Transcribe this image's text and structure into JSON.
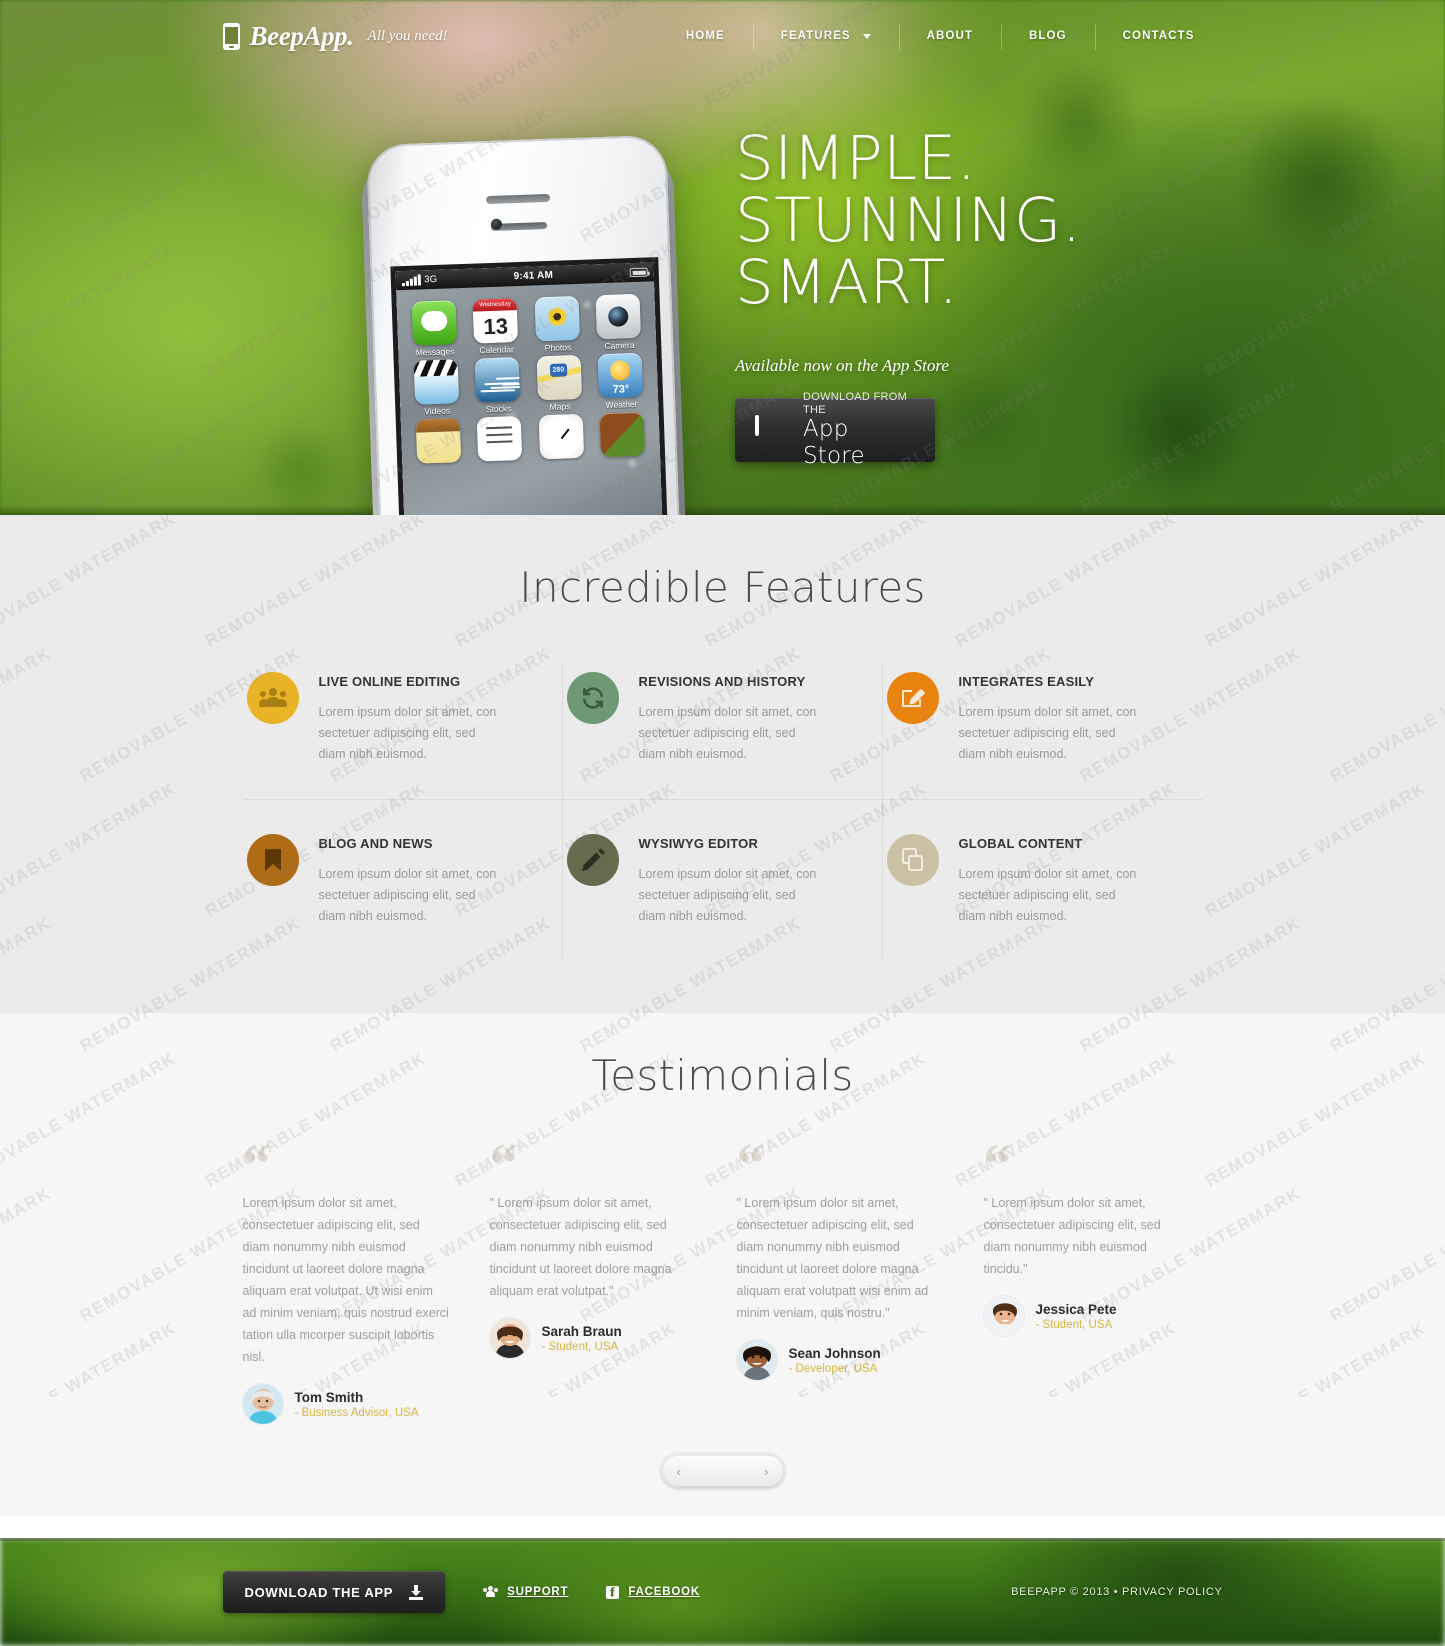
{
  "header": {
    "logo": {
      "name": "BeepApp.",
      "tagline": "All you need!",
      "icon": "phone-icon"
    },
    "nav": [
      {
        "label": "HOME",
        "has_dropdown": false
      },
      {
        "label": "FEATURES",
        "has_dropdown": true
      },
      {
        "label": "ABOUT",
        "has_dropdown": false
      },
      {
        "label": "BLOG",
        "has_dropdown": false
      },
      {
        "label": "CONTACTS",
        "has_dropdown": false
      }
    ]
  },
  "hero": {
    "headline_line1": "SIMPLE.",
    "headline_line2": "STUNNING.",
    "headline_line3": "SMART.",
    "subtitle": "Available now on the App Store",
    "cta": {
      "small": "DOWNLOAD FROM THE",
      "big": "App Store",
      "icon": "monitor-icon"
    },
    "phone": {
      "carrier": "3G",
      "time": "9:41 AM",
      "apps": [
        {
          "label": "Messages"
        },
        {
          "label": "Calendar",
          "weekday": "Wednesday",
          "day": "13"
        },
        {
          "label": "Photos"
        },
        {
          "label": "Camera"
        },
        {
          "label": "Videos"
        },
        {
          "label": "Stocks"
        },
        {
          "label": "Maps",
          "route": "280"
        },
        {
          "label": "Weather",
          "temp": "73°"
        }
      ]
    }
  },
  "features": {
    "title": "Incredible Features",
    "items": [
      {
        "title": "LIVE ONLINE EDITING",
        "text": "Lorem ipsum dolor sit amet, con sectetuer adipiscing elit, sed diam nibh euismod.",
        "icon": "users-icon",
        "color": "#e8b327",
        "glyph_color": "#a87f12"
      },
      {
        "title": "REVISIONS AND HISTORY",
        "text": "Lorem ipsum dolor sit amet, con sectetuer adipiscing elit, sed diam nibh euismod.",
        "icon": "refresh-icon",
        "color": "#6f9874",
        "glyph_color": "#3c5a41"
      },
      {
        "title": "INTEGRATES EASILY",
        "text": "Lorem ipsum dolor sit amet, con sectetuer adipiscing elit, sed diam nibh euismod.",
        "icon": "edit-box-icon",
        "color": "#e8830f",
        "glyph_color": "#f6e9d5"
      },
      {
        "title": "BLOG AND NEWS",
        "text": "Lorem ipsum dolor sit amet, con sectetuer adipiscing elit, sed diam nibh euismod.",
        "icon": "bookmark-icon",
        "color": "#b06c15",
        "glyph_color": "#5c3806"
      },
      {
        "title": "WYSIWYG EDITOR",
        "text": "Lorem ipsum dolor sit amet, con sectetuer adipiscing elit, sed diam nibh euismod.",
        "icon": "pencil-icon",
        "color": "#666b4e",
        "glyph_color": "#2d3020"
      },
      {
        "title": "GLOBAL CONTENT",
        "text": "Lorem ipsum dolor sit amet, con sectetuer adipiscing elit, sed diam nibh euismod.",
        "icon": "copy-icon",
        "color": "#cbc0a3",
        "glyph_color": "#f2eee3"
      }
    ]
  },
  "testimonials": {
    "title": "Testimonials",
    "items": [
      {
        "quote": "Lorem ipsum dolor sit amet, consectetuer adipiscing elit, sed diam nonummy nibh euismod tincidunt ut laoreet dolore magna aliquam erat volutpat. Ut wisi enim ad minim veniam, quis nostrud exerci tation ulla mcorper suscipit lobortis nisl.",
        "name": "Tom Smith",
        "role": "- Business Advisor, USA",
        "avatar": "avatar-tom"
      },
      {
        "quote": "\" Lorem ipsum dolor sit amet, consectetuer adipiscing elit, sed diam nonummy nibh euismod tincidunt ut laoreet dolore magna aliquam erat volutpat.\"",
        "name": "Sarah Braun",
        "role": "- Student, USA",
        "avatar": "avatar-sarah"
      },
      {
        "quote": "\" Lorem ipsum dolor sit amet, consectetuer adipiscing elit, sed diam nonummy nibh euismod tincidunt ut laoreet dolore magna aliquam erat volutpatt wisi enim ad minim veniam, quis nostru.\"",
        "name": "Sean Johnson",
        "role": "- Developer, USA",
        "avatar": "avatar-sean"
      },
      {
        "quote": "\" Lorem ipsum dolor sit amet, consectetuer adipiscing elit, sed diam nonummy nibh euismod tincidu.\"",
        "name": "Jessica Pete",
        "role": "- Student, USA",
        "avatar": "avatar-jessica"
      }
    ],
    "carousel": {
      "prev": "‹",
      "next": "›"
    }
  },
  "footer": {
    "download_button": {
      "label": "DOWNLOAD THE APP",
      "icon": "download-icon"
    },
    "links": [
      {
        "label": "SUPPORT",
        "icon": "users-icon"
      },
      {
        "label": "FACEBOOK",
        "icon": "facebook-icon"
      }
    ],
    "copyright": "BEEPAPP © 2013 • PRIVACY POLICY"
  },
  "watermark": {
    "text": "REMOVABLE WATERMARK"
  }
}
